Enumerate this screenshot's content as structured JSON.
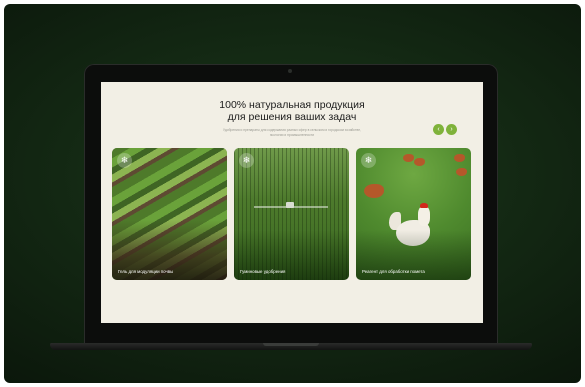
{
  "heading": {
    "line1": "100% натуральная продукция",
    "line2": "для решения ваших задач"
  },
  "subtitle": "Удобрения и препараты для содержания разных сфер в сельском и городском хозяйстве, экологии и промышленности",
  "navigation": {
    "prev_icon": "‹",
    "next_icon": "›",
    "accent_color": "#7fb23a"
  },
  "cards": [
    {
      "icon": "snowflake-icon",
      "glyph": "❄",
      "label": "Гель для модуляции почвы"
    },
    {
      "icon": "snowflake-icon",
      "glyph": "❄",
      "label": "Гуминовые удобрения"
    },
    {
      "icon": "snowflake-icon",
      "glyph": "❄",
      "label": "Реагент для обработки помета"
    }
  ],
  "colors": {
    "screen_bg": "#f2efe5",
    "backdrop": "#142a14"
  }
}
